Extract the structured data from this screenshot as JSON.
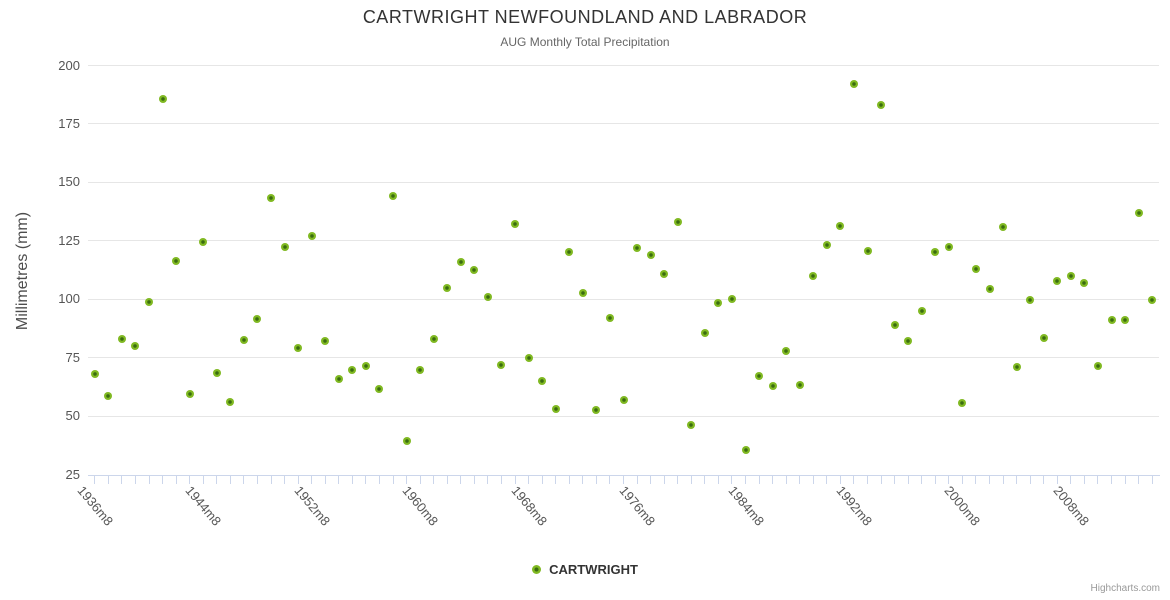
{
  "chart": {
    "title": "CARTWRIGHT NEWFOUNDLAND AND LABRADOR",
    "subtitle": "AUG Monthly Total Precipitation",
    "y_axis_title": "Millimetres (mm)",
    "legend_label": "CARTWRIGHT",
    "credits": "Highcharts.com",
    "colors": {
      "marker_outer": "#80b922",
      "marker_core": "#3a6c10",
      "gridline": "#e6e6e6",
      "axis_line": "#ccd6eb",
      "title_text": "#333333",
      "subtitle_text": "#666666",
      "axis_label_text": "#555555",
      "credits_text": "#999999"
    }
  },
  "chart_data": {
    "type": "scatter",
    "title": "CARTWRIGHT NEWFOUNDLAND AND LABRADOR",
    "subtitle": "AUG Monthly Total Precipitation",
    "xlabel": "",
    "ylabel": "Millimetres (mm)",
    "ylim": [
      25,
      200
    ],
    "y_ticks": [
      25,
      50,
      75,
      100,
      125,
      150,
      175,
      200
    ],
    "grid": "horizontal",
    "legend_position": "bottom-center",
    "x_label_every": 8,
    "x_label_suffix": "m8",
    "x_tick_labels": [
      "1936m8",
      "1944m8",
      "1952m8",
      "1960m8",
      "1968m8",
      "1976m8",
      "1984m8",
      "1992m8",
      "2000m8",
      "2008m8"
    ],
    "categories": [
      1936,
      1937,
      1938,
      1939,
      1940,
      1941,
      1942,
      1943,
      1944,
      1945,
      1946,
      1947,
      1948,
      1949,
      1950,
      1951,
      1952,
      1953,
      1954,
      1955,
      1956,
      1957,
      1958,
      1959,
      1960,
      1961,
      1962,
      1963,
      1964,
      1965,
      1966,
      1967,
      1968,
      1969,
      1970,
      1971,
      1972,
      1973,
      1974,
      1975,
      1976,
      1977,
      1978,
      1979,
      1980,
      1981,
      1982,
      1983,
      1984,
      1985,
      1986,
      1987,
      1988,
      1989,
      1990,
      1991,
      1992,
      1993,
      1994,
      1995,
      1996,
      1997,
      1998,
      1999,
      2000,
      2001,
      2002,
      2003,
      2004,
      2005,
      2006,
      2007,
      2008,
      2009,
      2010,
      2011,
      2012,
      2013,
      2014
    ],
    "series": [
      {
        "name": "CARTWRIGHT",
        "color": "#80b922",
        "values": [
          68,
          58.5,
          83,
          80,
          99,
          185.5,
          116.5,
          59.5,
          124.5,
          68.5,
          56,
          82.5,
          91.5,
          143.5,
          122.5,
          79,
          127,
          82,
          66,
          69.5,
          71.5,
          61.5,
          144,
          39.5,
          69.5,
          83,
          105,
          116,
          112.5,
          101,
          72,
          132,
          75,
          65,
          53,
          120,
          102.5,
          52.5,
          92,
          57,
          122,
          119,
          111,
          133,
          46,
          85.5,
          98.5,
          100,
          35.5,
          67,
          63,
          78,
          63.5,
          110,
          123,
          131.5,
          192,
          120.5,
          183,
          89,
          82,
          95,
          120,
          122.5,
          55.5,
          113,
          104.5,
          131,
          71,
          99.5,
          83.5,
          108,
          110,
          107,
          71.5,
          91,
          91,
          137,
          99.5
        ]
      }
    ]
  }
}
